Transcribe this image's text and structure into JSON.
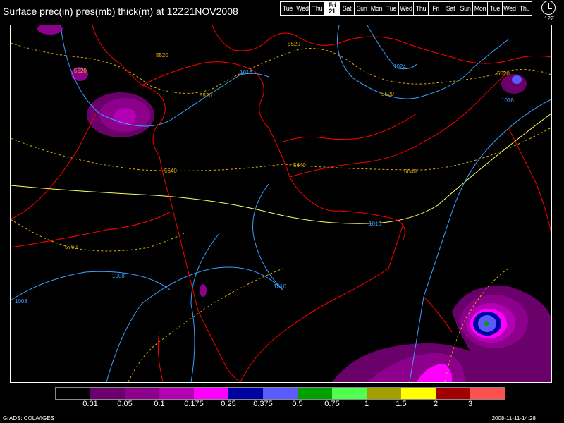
{
  "title": "Surface prec(in) pres(mb) thick(m) at 12Z21NOV2008",
  "days": [
    "Tue",
    "Wed",
    "Thu",
    "Fri 21",
    "Sat",
    "Sun",
    "Mon",
    "Tue",
    "Wed",
    "Thu",
    "Fri",
    "Sat",
    "Sun",
    "Mon",
    "Tue",
    "Wed",
    "Thu"
  ],
  "selected_day_index": 10,
  "selected_day": {
    "name": "Fri",
    "num": "21"
  },
  "clock_label": "12Z",
  "colorbar": {
    "colors": [
      "#000000",
      "#6a006a",
      "#8c008c",
      "#b400b4",
      "#ff00ff",
      "#0000a0",
      "#5a5aff",
      "#00a000",
      "#50ff50",
      "#a0a000",
      "#ffff00",
      "#a00000",
      "#ff5050"
    ],
    "labels": [
      "0.01",
      "0.05",
      "0.1",
      "0.175",
      "0.25",
      "0.375",
      "0.5",
      "0.75",
      "1",
      "1.5",
      "2",
      "3"
    ]
  },
  "pressure_labels": [
    "1016",
    "1024",
    "1016",
    "1016",
    "1016",
    "1008",
    "1008"
  ],
  "thickness_labels": [
    "5520",
    "5520",
    "5520",
    "5520",
    "5520",
    "5520",
    "5640",
    "5640",
    "5640",
    "5760"
  ],
  "credit": "GrADS: COLA/IGES",
  "timestamp": "2008-11-11-14:28",
  "colors": {
    "borders": "#ff0000",
    "isobars": "#3aa0ff",
    "thickness": "#e0b000",
    "thickness_5760": "#ffff60"
  }
}
